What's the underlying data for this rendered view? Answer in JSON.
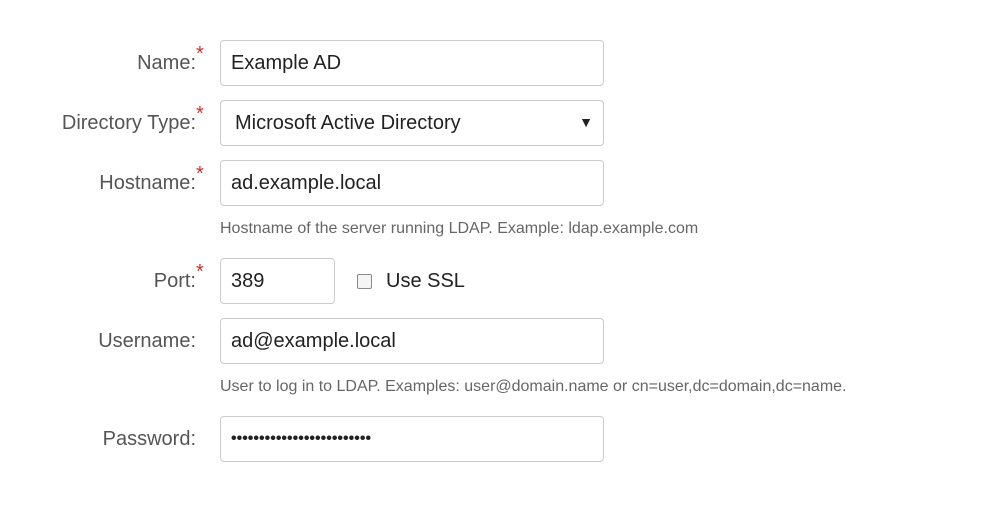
{
  "form": {
    "required_marker": "*",
    "name": {
      "label": "Name:",
      "value": "Example AD"
    },
    "directory_type": {
      "label": "Directory Type:",
      "selected": "Microsoft Active Directory",
      "caret": "▼"
    },
    "hostname": {
      "label": "Hostname:",
      "value": "ad.example.local",
      "help": "Hostname of the server running LDAP. Example: ldap.example.com"
    },
    "port": {
      "label": "Port:",
      "value": "389",
      "ssl_label": "Use SSL",
      "ssl_checked": false
    },
    "username": {
      "label": "Username:",
      "value": "ad@example.local",
      "help": "User to log in to LDAP. Examples: user@domain.name or cn=user,dc=domain,dc=name."
    },
    "password": {
      "label": "Password:",
      "masked_value": "•••••••••••••••••••••••••"
    }
  }
}
